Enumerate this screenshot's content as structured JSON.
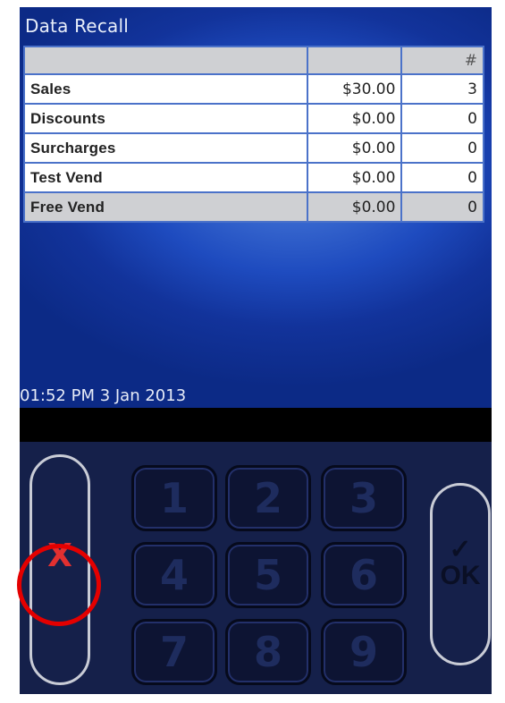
{
  "screen": {
    "title": "Data Recall",
    "table": {
      "header": {
        "label": "",
        "amount": "",
        "count": "#"
      },
      "rows": [
        {
          "label": "Sales",
          "amount": "$30.00",
          "count": "3"
        },
        {
          "label": "Discounts",
          "amount": "$0.00",
          "count": "0"
        },
        {
          "label": "Surcharges",
          "amount": "$0.00",
          "count": "0"
        },
        {
          "label": "Test Vend",
          "amount": "$0.00",
          "count": "0"
        },
        {
          "label": "Free Vend",
          "amount": "$0.00",
          "count": "0"
        }
      ]
    },
    "timestamp": "01:52 PM 3 Jan 2013"
  },
  "keypad": {
    "cancel_label": "X",
    "ok_label": "OK",
    "ok_check": "✓",
    "keys": [
      "1",
      "2",
      "3",
      "4",
      "5",
      "6",
      "7",
      "8",
      "9"
    ]
  },
  "colors": {
    "highlight_ring": "#e40000",
    "cancel_x": "#e23030"
  }
}
